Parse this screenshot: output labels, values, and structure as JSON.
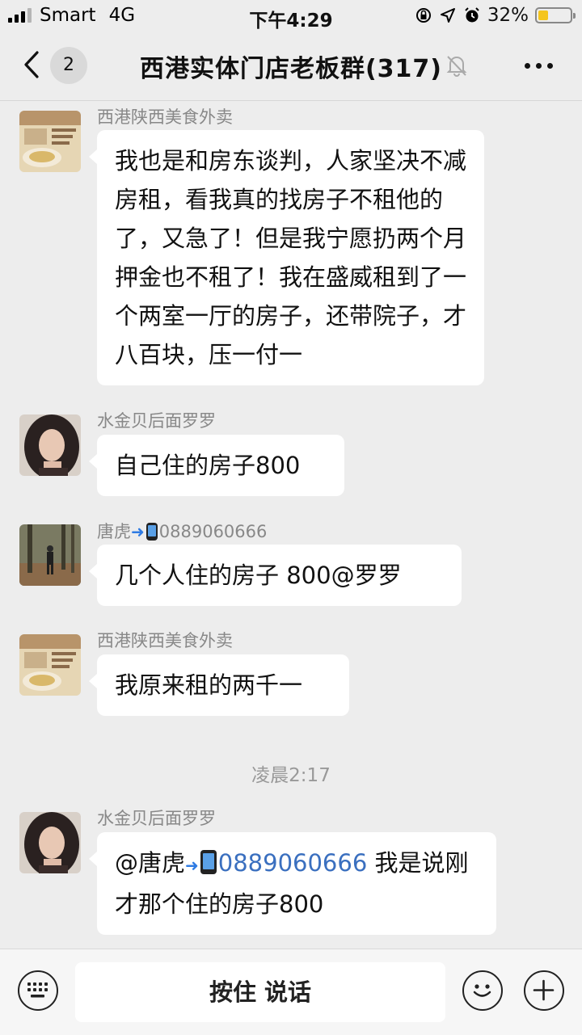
{
  "status_bar": {
    "carrier": "Smart",
    "network": "4G",
    "time": "下午4:29",
    "battery_text": "32%",
    "battery_level": 0.32
  },
  "nav": {
    "unread_count": "2",
    "title": "西港实体门店老板群(317)"
  },
  "messages": [
    {
      "sender": "西港陕西美食外卖",
      "text": "我也是和房东谈判，人家坚决不减房租，看我真的找房子不租他的了，又急了！但是我宁愿扔两个月押金也不租了！我在盛威租到了一个两室一厅的房子，还带院子，才八百块，压一付一"
    },
    {
      "sender": "水金贝后面罗罗",
      "text": "自己住的房子800"
    },
    {
      "sender_name": "唐虎",
      "sender_phone": "0889060666",
      "text": "几个人住的房子 800@罗罗"
    },
    {
      "sender": "西港陕西美食外卖",
      "text": "我原来租的两千一"
    },
    {
      "sender": "水金贝后面罗罗",
      "mention": "@唐虎",
      "phone": "0889060666",
      "text_rest": " 我是说刚才那个住的房子800"
    }
  ],
  "timestamp": "凌晨2:17",
  "input_bar": {
    "talk_label": "按住 说话"
  }
}
